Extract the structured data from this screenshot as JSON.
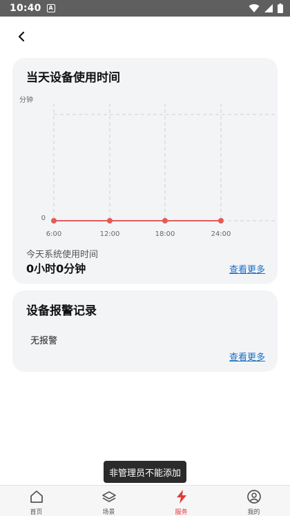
{
  "status_bar": {
    "time": "10:40",
    "notification_badge": "A"
  },
  "usage_card": {
    "title": "当天设备使用时间",
    "more_label": "查看更多",
    "today_label": "今天系统使用时间",
    "today_value": "0小时0分钟"
  },
  "chart_data": {
    "type": "line",
    "ylabel": "分钟",
    "x": [
      "6:00",
      "12:00",
      "18:00",
      "24:00"
    ],
    "series": [
      {
        "values": [
          0,
          0,
          0,
          0
        ]
      }
    ],
    "y_tick_labels": [
      "0"
    ],
    "ylim": [
      0,
      1
    ],
    "grid": true,
    "line_color": "#e25b5b",
    "grid_color": "#cfcfcf"
  },
  "alarm_card": {
    "title": "设备报警记录",
    "empty_text": "无报警",
    "more_label": "查看更多"
  },
  "toast": {
    "text": "非管理员不能添加"
  },
  "bottom_nav": {
    "items": [
      {
        "label": "首页",
        "icon": "home-icon"
      },
      {
        "label": "场景",
        "icon": "layers-icon"
      },
      {
        "label": "服务",
        "icon": "lightning-icon",
        "active": true
      },
      {
        "label": "我的",
        "icon": "user-circle-icon"
      }
    ],
    "active_color": "#e23a3a"
  }
}
